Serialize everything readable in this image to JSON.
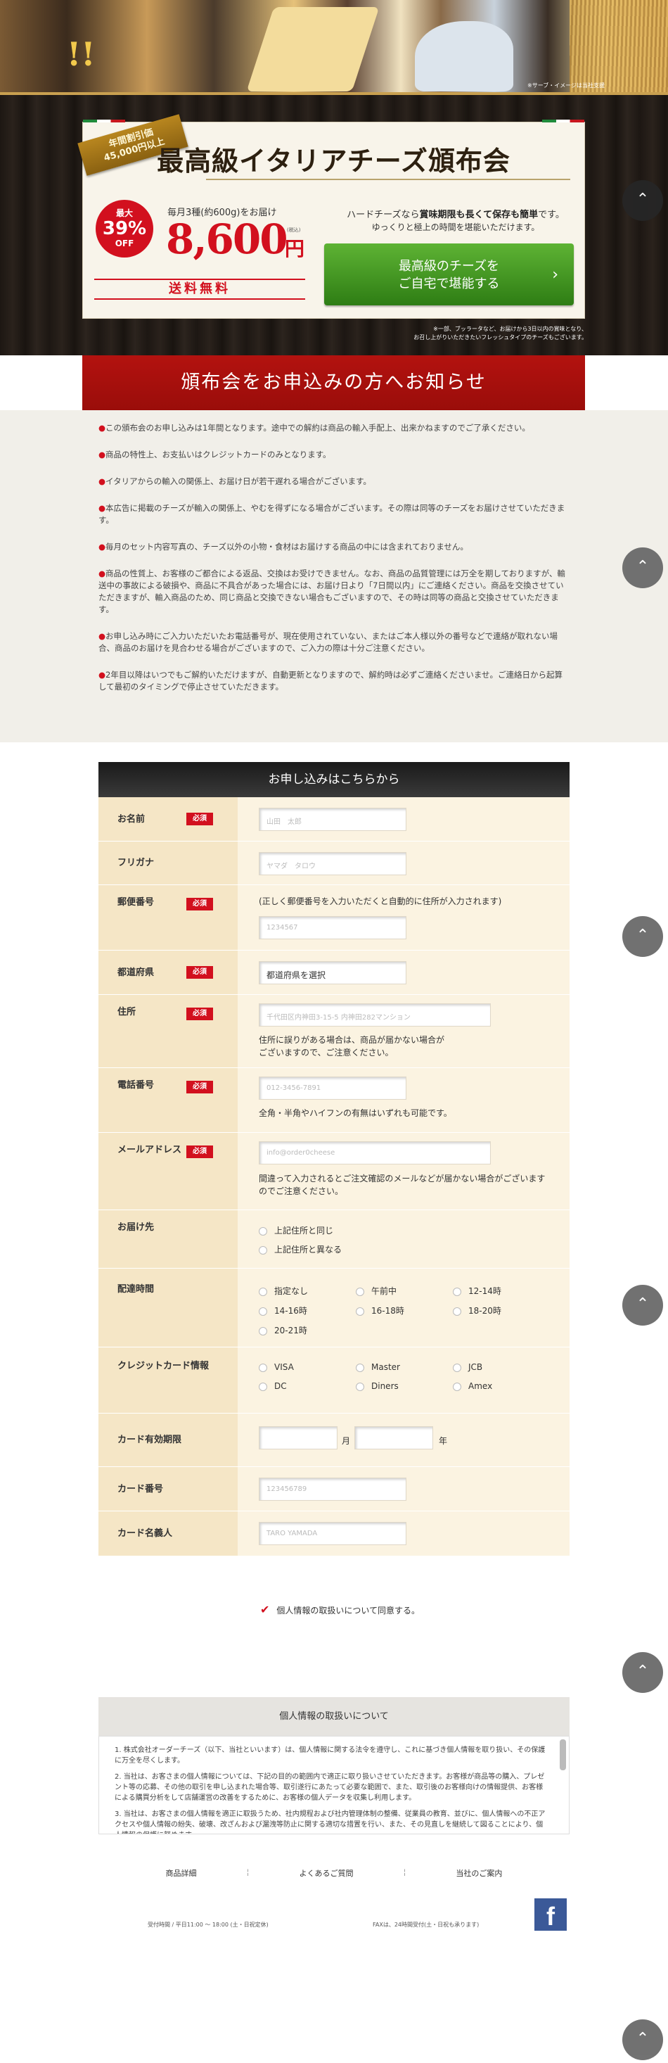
{
  "hero": {
    "photo_note": "※サーブ・イメージは当社支援",
    "ribbon_line1": "年間割引価",
    "ribbon_line2": "45,000円以上",
    "title": "最高級イタリアチーズ頒布会",
    "discount_prefix": "最大",
    "discount_value": "39%",
    "discount_suffix": "OFF",
    "monthly": "毎月3種(約600g)をお届け",
    "price": "8,600",
    "price_unit": "円",
    "tax": "(税込)",
    "shipping": "送料無料",
    "hard_pre": "ハードチーズなら",
    "hard_hl": "賞味期限も長くて保存も簡単",
    "hard_post": "です。",
    "hard_line2": "ゆっくりと極上の時間を堪能いただけます。",
    "cta_line1": "最高級のチーズを",
    "cta_line2": "ご自宅で堪能する",
    "cta_arrow": "›",
    "footnote1": "※一部、ブッラータなど、お届けから3日以内の賞味となり、",
    "footnote2": "お召し上がりいただきたいフレッシュタイプのチーズもございます。"
  },
  "notice": {
    "title": "頒布会をお申込みの方へお知らせ",
    "items": [
      "この頒布会のお申し込みは1年間となります。途中での解約は商品の輸入手配上、出来かねますのでご了承ください。",
      "商品の特性上、お支払いはクレジットカードのみとなります。",
      "イタリアからの輸入の関係上、お届け日が若干遅れる場合がございます。",
      "本広告に掲載のチーズが輸入の関係上、やむを得ずになる場合がございます。その際は同等のチーズをお届けさせていただきます。",
      "毎月のセット内容写真の、チーズ以外の小物・食材はお届けする商品の中には含まれておりません。",
      "商品の性質上、お客様のご都合による返品、交換はお受けできません。なお、商品の品質管理には万全を期しておりますが、輸送中の事故による破損や、商品に不具合があった場合には、お届け日より「7日間以内」にご連絡ください。商品を交換させていただきますが、輸入商品のため、同じ商品と交換できない場合もございますので、その時は同等の商品と交換させていただきます。",
      "お申し込み時にご入力いただいたお電話番号が、現在使用されていない、またはご本人様以外の番号などで連絡が取れない場合、商品のお届けを見合わせる場合がございますので、ご入力の際は十分ご注意ください。",
      "2年目以降はいつでもご解約いただけますが、自動更新となりますので、解約時は必ずご連絡くださいませ。ご連絡日から起算して最初のタイミングで停止させていただきます。"
    ]
  },
  "form": {
    "heading": "お申し込みはこちらから",
    "required": "必須",
    "name_label": "お名前",
    "name_placeholder": "山田　太郎",
    "kana_label": "フリガナ",
    "kana_placeholder": "ヤマダ　タロウ",
    "zip_label": "郵便番号",
    "zip_hint": "(正しく郵便番号を入力いただくと自動的に住所が入力されます)",
    "zip_placeholder": "1234567",
    "pref_label": "都道府県",
    "pref_value": "都道府県を選択",
    "addr_label": "住所",
    "addr_placeholder": "千代田区内神田3-15-5 内神田282マンション",
    "addr_hint1": "住所に誤りがある場合は、商品が届かない場合が",
    "addr_hint2": "ございますので、ご注意ください。",
    "tel_label": "電話番号",
    "tel_placeholder": "012-3456-7891",
    "tel_hint": "全角・半角やハイフンの有無はいずれも可能です。",
    "mail_label": "メールアドレス",
    "mail_placeholder": "info@order0cheese",
    "mail_hint1": "間違って入力されるとご注文確認のメールなどが届かない場合がございます",
    "mail_hint2": "のでご注意ください。",
    "dest_label": "お届け先",
    "dest_options": [
      "上記住所と同じ",
      "上記住所と異なる"
    ],
    "time_label": "配達時間",
    "time_options": [
      "指定なし",
      "午前中",
      "12-14時",
      "14-16時",
      "16-18時",
      "18-20時",
      "20-21時"
    ],
    "card_label": "クレジットカード情報",
    "card_options": [
      "VISA",
      "Master",
      "JCB",
      "DC",
      "Diners",
      "Amex"
    ],
    "exp_label": "カード有効期限",
    "exp_month": "月",
    "exp_year": "年",
    "cardno_label": "カード番号",
    "cardno_placeholder": "123456789",
    "holder_label": "カード名義人",
    "holder_placeholder": "TARO YAMADA",
    "agree": "個人情報の取扱いについて同意する。",
    "agree_mark": "✔"
  },
  "privacy": {
    "title": "個人情報の取扱いについて",
    "paragraphs": [
      "1. 株式会社オーダーチーズ（以下、当社といいます）は、個人情報に関する法令を遵守し、これに基づき個人情報を取り扱い、その保護に万全を尽くします。",
      "2. 当社は、お客さまの個人情報については、下記の目的の範囲内で適正に取り扱いさせていただきます。お客様が商品等の購入、プレゼント等の応募、その他の取引を申し込まれた場合等、取引遂行にあたって必要な範囲で、また、取引後のお客様向けの情報提供、お客様による購買分析をして店舗運営の改善をするために、お客様の個人データを収集し利用します。",
      "3. 当社は、お客さまの個人情報を適正に取扱うため、社内規程および社内管理体制の整備、従業員の教育、並びに、個人情報への不正アクセスや個人情報の紛失、破壊、改ざんおよび漏洩等防止に関する適切な措置を行い、また、その見直しを継続して図ることにより、個人情報の保護に努めます。"
    ]
  },
  "footer": {
    "nav": [
      "商品詳細",
      "よくあるご質問",
      "当社のご案内"
    ],
    "separator": "¦",
    "hours": "受付時間 / 平日11:00 〜 18:00 (土・日祝定休)",
    "fax": "FAXは、24時間受付(土・日祝も承ります)",
    "fb": "f"
  },
  "scroll_top_icon": "⌃"
}
